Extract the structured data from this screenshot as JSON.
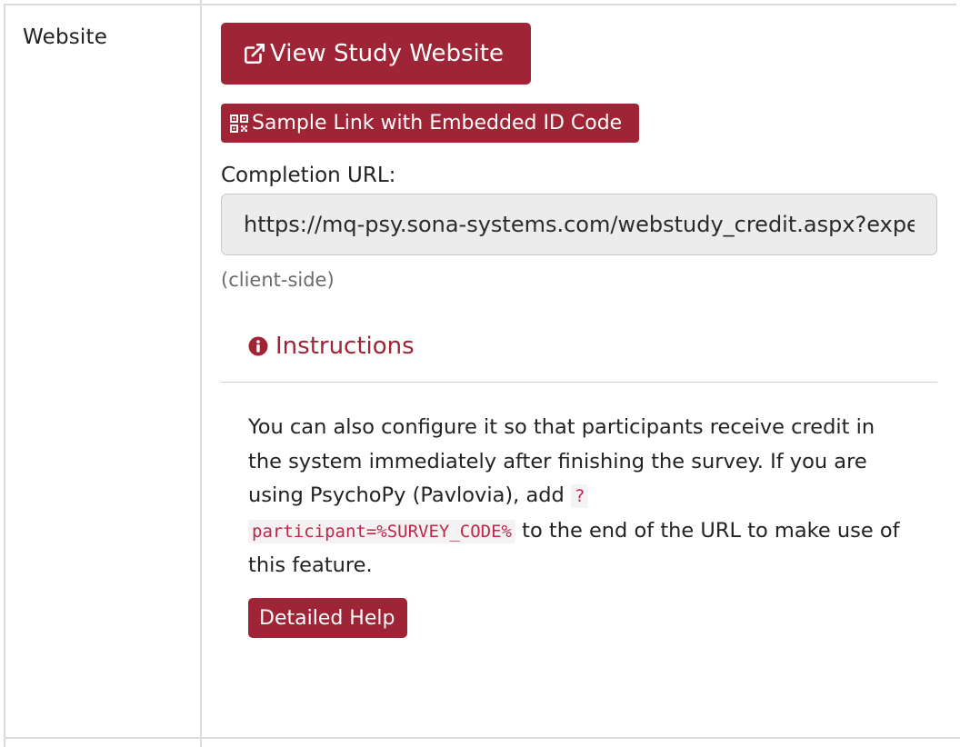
{
  "row": {
    "label": "Website"
  },
  "buttons": {
    "view_study_website": "View Study Website",
    "sample_link": "Sample Link with Embedded ID Code",
    "detailed_help": "Detailed Help"
  },
  "completion": {
    "label": "Completion URL:",
    "url_value": "https://mq-psy.sona-systems.com/webstudy_credit.aspx?experiment_id=",
    "note": "(client-side)"
  },
  "instructions": {
    "header": "Instructions",
    "text_before_code": "You can also configure it so that participants receive credit in the system immediately after finishing the survey. If you are using PsychoPy (Pavlovia), add ",
    "code_part1": "?",
    "code_part2": "participant=%SURVEY_CODE%",
    "text_after_code": " to the end of the URL to make use of this feature."
  },
  "icons": {
    "external_link": "external-link-icon",
    "qr_code": "qr-code-icon",
    "info": "info-circle-icon"
  },
  "colors": {
    "brand": "#9e2436",
    "code_text": "#c0254a",
    "input_bg": "#ececec",
    "muted_text": "#6b6b6b"
  }
}
